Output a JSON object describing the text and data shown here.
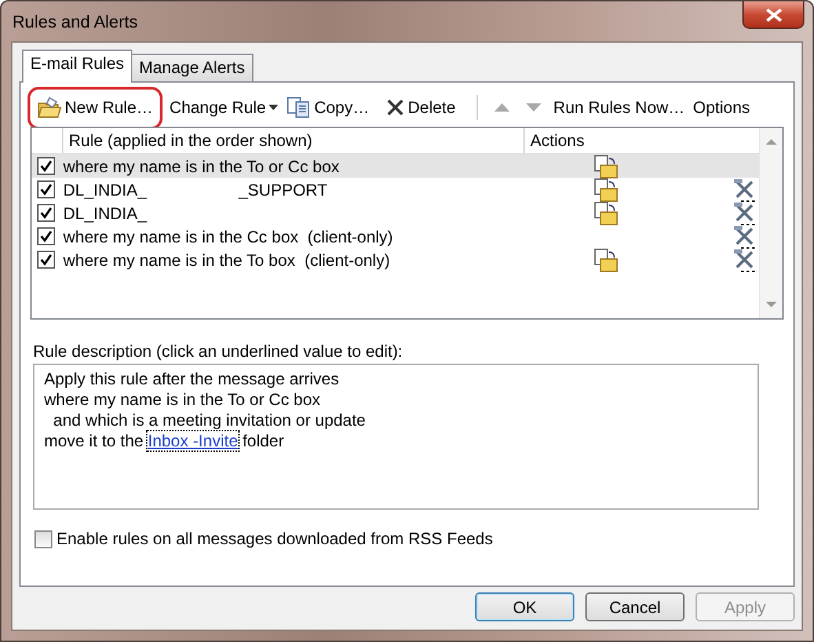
{
  "window": {
    "title": "Rules and Alerts"
  },
  "tabs": [
    {
      "label": "E-mail Rules",
      "selected": true
    },
    {
      "label": "Manage Alerts",
      "selected": false
    }
  ],
  "toolbar": [
    {
      "kind": "new",
      "label": "New Rule…",
      "highlighted": true
    },
    {
      "kind": "menu",
      "label": "Change Rule"
    },
    {
      "kind": "copy",
      "label": "Copy…",
      "highlighted": false
    },
    {
      "kind": "delete",
      "label": "Delete",
      "highlighted": false
    },
    {
      "kind": "separator"
    },
    {
      "kind": "up",
      "disabled": true
    },
    {
      "kind": "down",
      "disabled": true
    },
    {
      "kind": "text",
      "label": "Run Rules Now…"
    },
    {
      "kind": "text",
      "label": "Options"
    }
  ],
  "rules": {
    "columns": [
      "Rule (applied in the order shown)",
      "Actions"
    ],
    "rows": [
      {
        "checked": true,
        "name": "where my name is in the To or Cc box",
        "move": true,
        "client_only": false,
        "selected": true
      },
      {
        "checked": true,
        "name": "DL_INDIA_                    _SUPPORT",
        "move": true,
        "client_only": true,
        "selected": false
      },
      {
        "checked": true,
        "name": "DL_INDIA_",
        "move": true,
        "client_only": true,
        "selected": false
      },
      {
        "checked": true,
        "name": "where my name is in the Cc box  (client-only)",
        "move": false,
        "client_only": true,
        "selected": false
      },
      {
        "checked": true,
        "name": "where my name is in the To box  (client-only)",
        "move": true,
        "client_only": true,
        "selected": false
      }
    ]
  },
  "description": {
    "label": "Rule description (click an underlined value to edit):",
    "lines": [
      {
        "text": "Apply this rule after the message arrives"
      },
      {
        "text": "where my name is in the To or Cc box"
      },
      {
        "text": "  and which is a meeting invitation or update"
      },
      {
        "text": "move it to the ",
        "link": "Inbox -Invite",
        "after": " folder"
      }
    ]
  },
  "rss": {
    "label": "Enable rules on all messages downloaded from RSS Feeds",
    "checked": false
  },
  "buttons": [
    {
      "label": "OK",
      "default": true,
      "disabled": false
    },
    {
      "label": "Cancel",
      "default": false,
      "disabled": false
    },
    {
      "label": "Apply",
      "default": false,
      "disabled": true
    }
  ]
}
